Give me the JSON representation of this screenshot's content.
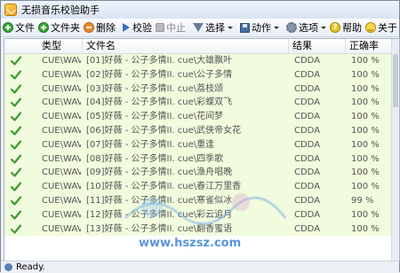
{
  "window": {
    "title": "无损音乐校验助手"
  },
  "toolbar": {
    "items": [
      {
        "label": "文件",
        "enabled": true
      },
      {
        "label": "文件夹",
        "enabled": true
      },
      {
        "label": "删除",
        "enabled": true
      },
      {
        "label": "校验",
        "enabled": true
      },
      {
        "label": "中止",
        "enabled": false
      },
      {
        "label": "选择",
        "enabled": true
      },
      {
        "label": "动作",
        "enabled": true
      },
      {
        "label": "选项",
        "enabled": true
      },
      {
        "label": "帮助",
        "enabled": true
      },
      {
        "label": "关于",
        "enabled": true
      }
    ]
  },
  "list": {
    "columns": [
      "类型",
      "文件名",
      "结果",
      "正确率"
    ],
    "rows": [
      {
        "type": "CUE\\WAV",
        "filename": "[01]好薇 - 公子多情II. cue\\大雄飘叶",
        "result": "CDDA",
        "rate": "100 %"
      },
      {
        "type": "CUE\\WAV",
        "filename": "[02]好薇 - 公子多情II. cue\\公子多情",
        "result": "CDDA",
        "rate": "100 %"
      },
      {
        "type": "CUE\\WAV",
        "filename": "[03]好薇 - 公子多情II. cue\\荔枝颂",
        "result": "CDDA",
        "rate": "100 %"
      },
      {
        "type": "CUE\\WAV",
        "filename": "[04]好薇 - 公子多情II. cue\\彩蝶双飞",
        "result": "CDDA",
        "rate": "100 %"
      },
      {
        "type": "CUE\\WAV",
        "filename": "[05]好薇 - 公子多情II. cue\\花间梦",
        "result": "CDDA",
        "rate": "100 %"
      },
      {
        "type": "CUE\\WAV",
        "filename": "[06]好薇 - 公子多情II. cue\\武侠帝女花",
        "result": "CDDA",
        "rate": "100 %"
      },
      {
        "type": "CUE\\WAV",
        "filename": "[07]好薇 - 公子多情II. cue\\重逢",
        "result": "CDDA",
        "rate": "100 %"
      },
      {
        "type": "CUE\\WAV",
        "filename": "[08]好薇 - 公子多情II. cue\\四季歌",
        "result": "CDDA",
        "rate": "100 %"
      },
      {
        "type": "CUE\\WAV",
        "filename": "[09]好薇 - 公子多情II. cue\\渔舟唱晚",
        "result": "CDDA",
        "rate": "100 %"
      },
      {
        "type": "CUE\\WAV",
        "filename": "[10]好薇 - 公子多情II. cue\\春江万里香",
        "result": "CDDA",
        "rate": "100 %"
      },
      {
        "type": "CUE\\WAV",
        "filename": "[11]好薇 - 公子多情II. cue\\寒雀似冰",
        "result": "CDDA",
        "rate": "99 %"
      },
      {
        "type": "CUE\\WAV",
        "filename": "[12]好薇 - 公子多情II. cue\\彩云追月",
        "result": "CDDA",
        "rate": "100 %"
      },
      {
        "type": "CUE\\WAV",
        "filename": "[13]好薇 - 公子多情II. cue\\翻香蜜语",
        "result": "CDDA",
        "rate": "100 %"
      }
    ]
  },
  "watermark": {
    "url": "www.hszsz.com"
  },
  "status": {
    "text": "Ready."
  }
}
